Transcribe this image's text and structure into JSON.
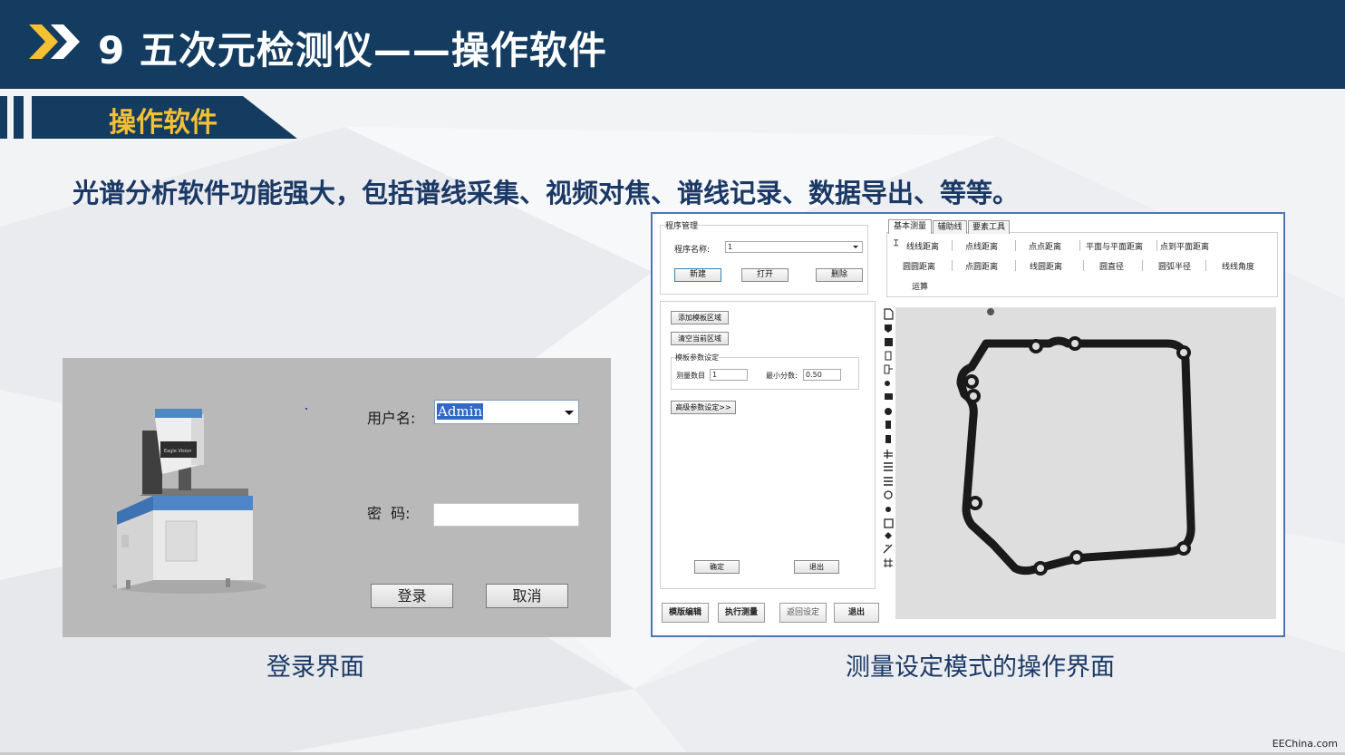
{
  "header": {
    "title": "9 五次元检测仪——操作软件"
  },
  "section": {
    "label": "操作软件"
  },
  "description": "光谱分析软件功能强大，包括谱线采集、视频对焦、谱线记录、数据导出、等等。",
  "login": {
    "username_label": "用户名:",
    "username_value": "Admin",
    "password_label": "密  码:",
    "login_button": "登录",
    "cancel_button": "取消",
    "machine_brand": "Eagle Vision"
  },
  "captions": {
    "login": "登录界面",
    "measure": "测量设定模式的操作界面"
  },
  "software": {
    "program_group": "程序管理",
    "program_name_label": "程序名称:",
    "program_name_value": "1",
    "new_btn": "新建",
    "open_btn": "打开",
    "delete_btn": "删除",
    "add_template_btn": "添加模板区域",
    "clear_region_btn": "清空当前区域",
    "template_group": "模板参数设定",
    "measure_count_label": "测量数目",
    "measure_count_value": "1",
    "min_score_label": "最小分数:",
    "min_score_value": "0.50",
    "advanced_btn": "高级参数设定>>",
    "confirm_btn": "确定",
    "exit_inner_btn": "退出",
    "tabs": [
      "基本测量",
      "辅助线",
      "要素工具"
    ],
    "tools_row1": [
      "线线距离",
      "点线距离",
      "点点距离",
      "平面与平面距离",
      "点到平面距离"
    ],
    "tools_row2": [
      "圆圆距离",
      "点圆距离",
      "线圆距离",
      "圆直径",
      "圆弧半径",
      "线线角度"
    ],
    "tools_row3": [
      "运算"
    ],
    "bottom_buttons": [
      "模版编辑",
      "执行测量",
      "返回设定",
      "退出"
    ]
  },
  "watermark": "EEChina.com",
  "colors": {
    "header": "#133c60",
    "accent_yellow": "#f6c033",
    "text_blue": "#1b3966"
  }
}
